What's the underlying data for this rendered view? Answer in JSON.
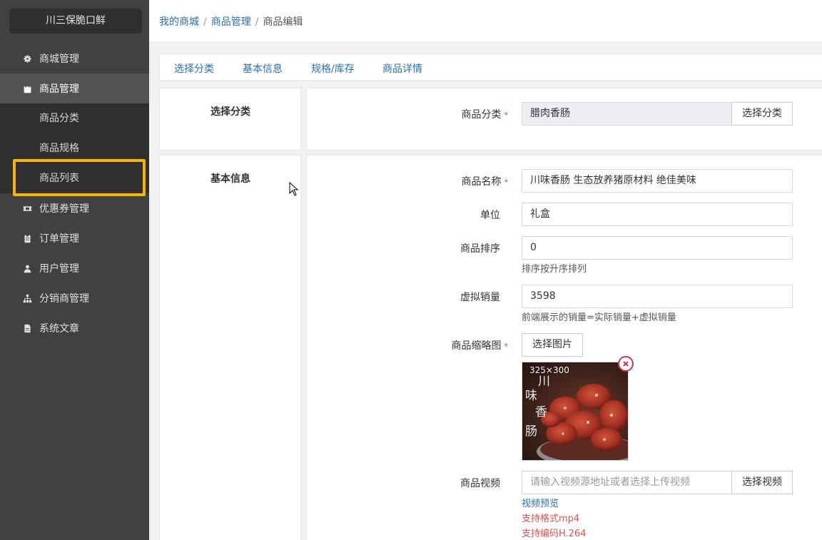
{
  "sidebar": {
    "shop_name": "川三保脆口鲜",
    "items": [
      {
        "label": "商城管理",
        "icon": "gear-icon"
      },
      {
        "label": "商品管理",
        "icon": "bag-icon"
      },
      {
        "label": "优惠券管理",
        "icon": "ticket-icon"
      },
      {
        "label": "订单管理",
        "icon": "clipboard-icon"
      },
      {
        "label": "用户管理",
        "icon": "user-icon"
      },
      {
        "label": "分销商管理",
        "icon": "sitemap-icon"
      },
      {
        "label": "系统文章",
        "icon": "document-icon"
      }
    ],
    "sub_items": [
      {
        "label": "商品分类"
      },
      {
        "label": "商品规格"
      },
      {
        "label": "商品列表"
      }
    ]
  },
  "breadcrumb": {
    "items": [
      "我的商城",
      "商品管理",
      "商品编辑"
    ],
    "separator": "/"
  },
  "tabs": [
    "选择分类",
    "基本信息",
    "规格/库存",
    "商品详情"
  ],
  "category_section": {
    "title": "选择分类",
    "label": "商品分类",
    "value": "腊肉香肠",
    "button": "选择分类"
  },
  "basic_section": {
    "title": "基本信息",
    "name_label": "商品名称",
    "name_value": "川味香肠 生态放养猪原材料 绝佳美味",
    "unit_label": "单位",
    "unit_value": "礼盒",
    "sort_label": "商品排序",
    "sort_value": "0",
    "sort_hint": "排序按升序排列",
    "virtual_sales_label": "虚拟销量",
    "virtual_sales_value": "3598",
    "virtual_sales_hint": "前端展示的销量=实际销量+虚拟销量",
    "thumb_label": "商品缩略图",
    "thumb_button": "选择图片",
    "thumb_size": "325×300",
    "thumb_image_text": [
      "川",
      "味",
      "香",
      "肠"
    ],
    "video_label": "商品视频",
    "video_placeholder": "请输入视频源地址或者选择上传视频",
    "video_button": "选择视频",
    "video_preview": "视频预览",
    "video_format_hint": "支持格式mp4",
    "video_codec_hint": "支持编码H.264"
  },
  "required_mark": "*",
  "colors": {
    "sidebar_bg": "#414141",
    "highlight": "#f7b500",
    "link": "#2a6fb0",
    "required": "#e53935",
    "warning_text": "#d9534f"
  }
}
